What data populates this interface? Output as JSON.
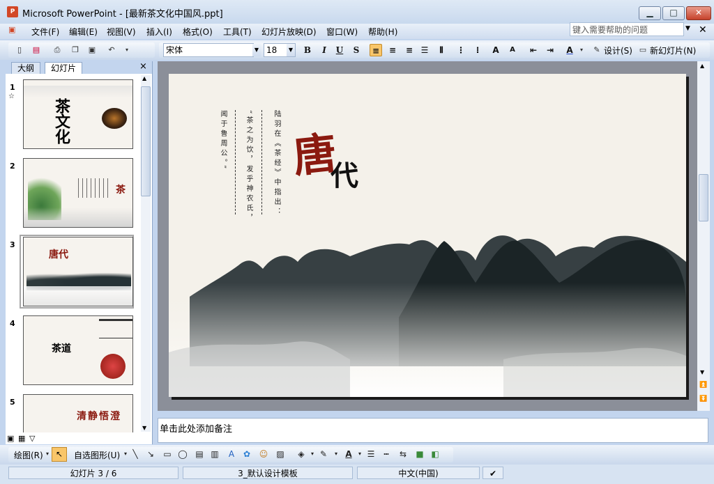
{
  "window": {
    "title": "Microsoft PowerPoint - [最新茶文化中国风.ppt]",
    "app_icon_label": "P",
    "controls": {
      "minimize": "▁",
      "maximize": "□",
      "close": "✕"
    }
  },
  "menubar": {
    "items": [
      "文件(F)",
      "编辑(E)",
      "视图(V)",
      "插入(I)",
      "格式(O)",
      "工具(T)",
      "幻灯片放映(D)",
      "窗口(W)",
      "帮助(H)"
    ],
    "help_placeholder": "键入需要帮助的问题",
    "doc_close": "✕"
  },
  "toolbar": {
    "font_name": "宋体",
    "font_size": "18",
    "bold": "B",
    "italic": "I",
    "underline": "U",
    "shadow": "S",
    "design_label": "设计(S)",
    "new_slide_label": "新幻灯片(N)"
  },
  "leftpane": {
    "tabs": [
      "大纲",
      "幻灯片"
    ],
    "close": "×",
    "slides": [
      {
        "num": "1",
        "text": "茶文化"
      },
      {
        "num": "2",
        "text": "茶"
      },
      {
        "num": "3",
        "text": "唐代"
      },
      {
        "num": "4",
        "text": "茶道"
      },
      {
        "num": "5",
        "text": "清静悟澄"
      }
    ]
  },
  "slide": {
    "title_red": "唐",
    "title_black": "代",
    "text_col1": "陆羽在《茶经》中指出：",
    "text_col2": "“茶之为饮，发乎神农氏，",
    "text_col3": "闻于鲁周公。”"
  },
  "notes": {
    "placeholder": "单击此处添加备注"
  },
  "drawbar": {
    "draw_label": "绘图(R)",
    "autoshapes_label": "自选图形(U)"
  },
  "statusbar": {
    "slide_info": "幻灯片 3 / 6",
    "template": "3_默认设计模板",
    "language": "中文(中国)"
  },
  "colors": {
    "accent_red": "#8b1a10",
    "selection": "#f9c66a"
  }
}
